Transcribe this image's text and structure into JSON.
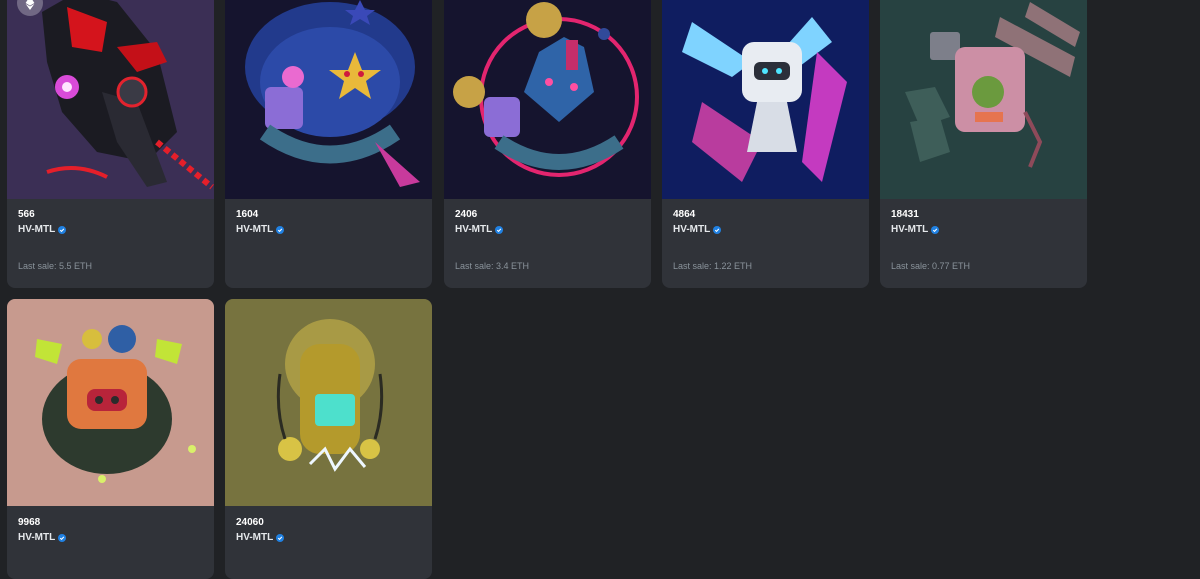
{
  "chain_badge": {
    "icon": "ethereum-icon"
  },
  "verified_icon": {
    "icon": "verified-badge-icon",
    "color": "#2081e2"
  },
  "cards": [
    {
      "token_id": "566",
      "collection": "HV-MTL",
      "last_sale": "Last sale: 5.5 ETH",
      "bg": "#3b2f55",
      "art_icon": "dark-mech-red-eyes-artwork"
    },
    {
      "token_id": "1604",
      "collection": "HV-MTL",
      "last_sale": "",
      "bg": "#15142e",
      "art_icon": "blue-mech-star-artwork"
    },
    {
      "token_id": "2406",
      "collection": "HV-MTL",
      "last_sale": "Last sale: 3.4 ETH",
      "bg": "#15142e",
      "art_icon": "mech-pink-ring-coins-artwork"
    },
    {
      "token_id": "4864",
      "collection": "HV-MTL",
      "last_sale": "Last sale: 1.22 ETH",
      "bg": "#0f1d60",
      "art_icon": "winged-white-mech-artwork"
    },
    {
      "token_id": "18431",
      "collection": "HV-MTL",
      "last_sale": "Last sale: 0.77 ETH",
      "bg": "#274241",
      "art_icon": "pink-mech-rockets-artwork"
    },
    {
      "token_id": "9968",
      "collection": "HV-MTL",
      "last_sale": "",
      "bg": "#c79a8e",
      "art_icon": "orange-spider-mech-artwork"
    },
    {
      "token_id": "24060",
      "collection": "HV-MTL",
      "last_sale": "",
      "bg": "#77733f",
      "art_icon": "yellow-mech-electric-artwork"
    }
  ]
}
